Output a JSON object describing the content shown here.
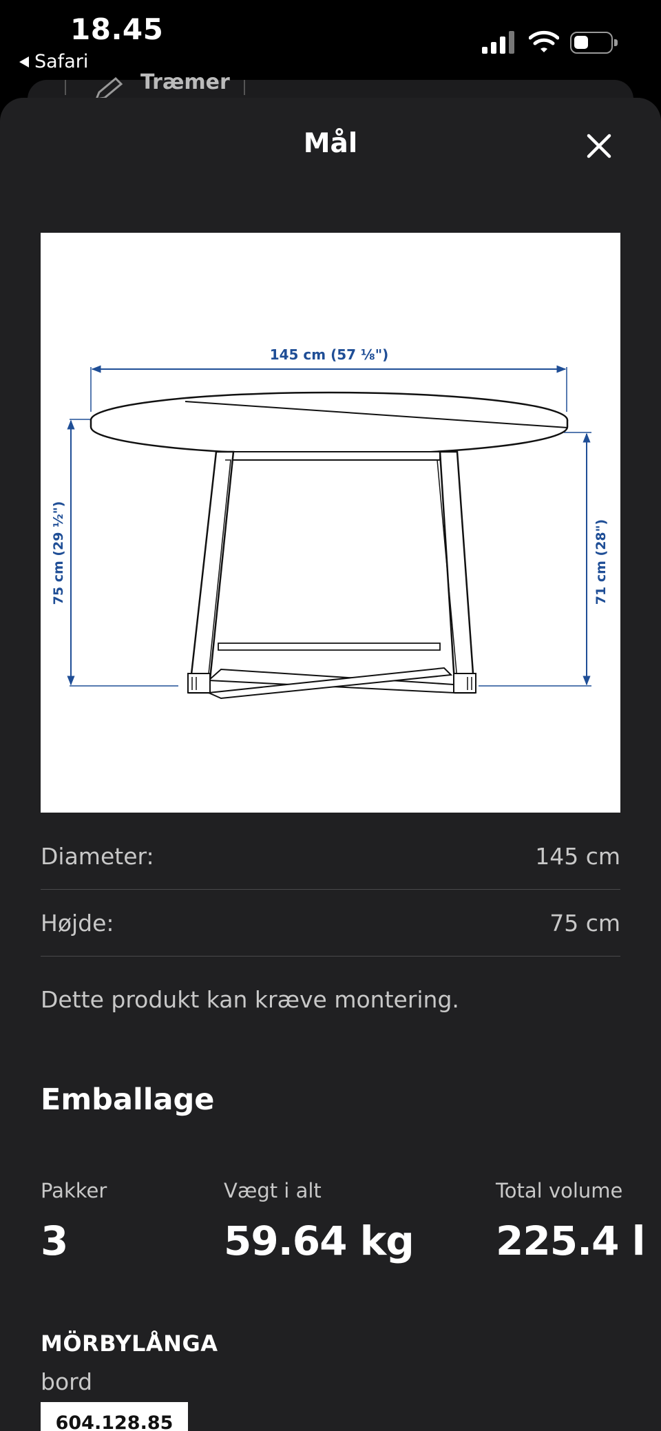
{
  "status_bar": {
    "time": "18.45",
    "back_app": "Safari"
  },
  "behind_sheet": {
    "peek_label": "Træmer"
  },
  "modal": {
    "title": "Mål"
  },
  "diagram": {
    "width_label": "145 cm (57 ⅛\")",
    "height_left_label": "75 cm (29 ½\")",
    "height_right_label": "71 cm (28\")"
  },
  "specs": [
    {
      "label": "Diameter:",
      "value": "145 cm"
    },
    {
      "label": "Højde:",
      "value": "75 cm"
    }
  ],
  "assembly_note": "Dette produkt kan kræve montering.",
  "packaging": {
    "title": "Emballage",
    "stats": [
      {
        "label": "Pakker",
        "value": "3"
      },
      {
        "label": "Vægt i alt",
        "value": "59.64 kg"
      },
      {
        "label": "Total volume",
        "value": "225.4 l"
      }
    ]
  },
  "product": {
    "name": "MÖRBYLÅNGA",
    "type": "bord",
    "article_number": "604.128.85"
  },
  "colors": {
    "sheet_bg": "#202022",
    "dimension_blue": "#1f4e96"
  }
}
